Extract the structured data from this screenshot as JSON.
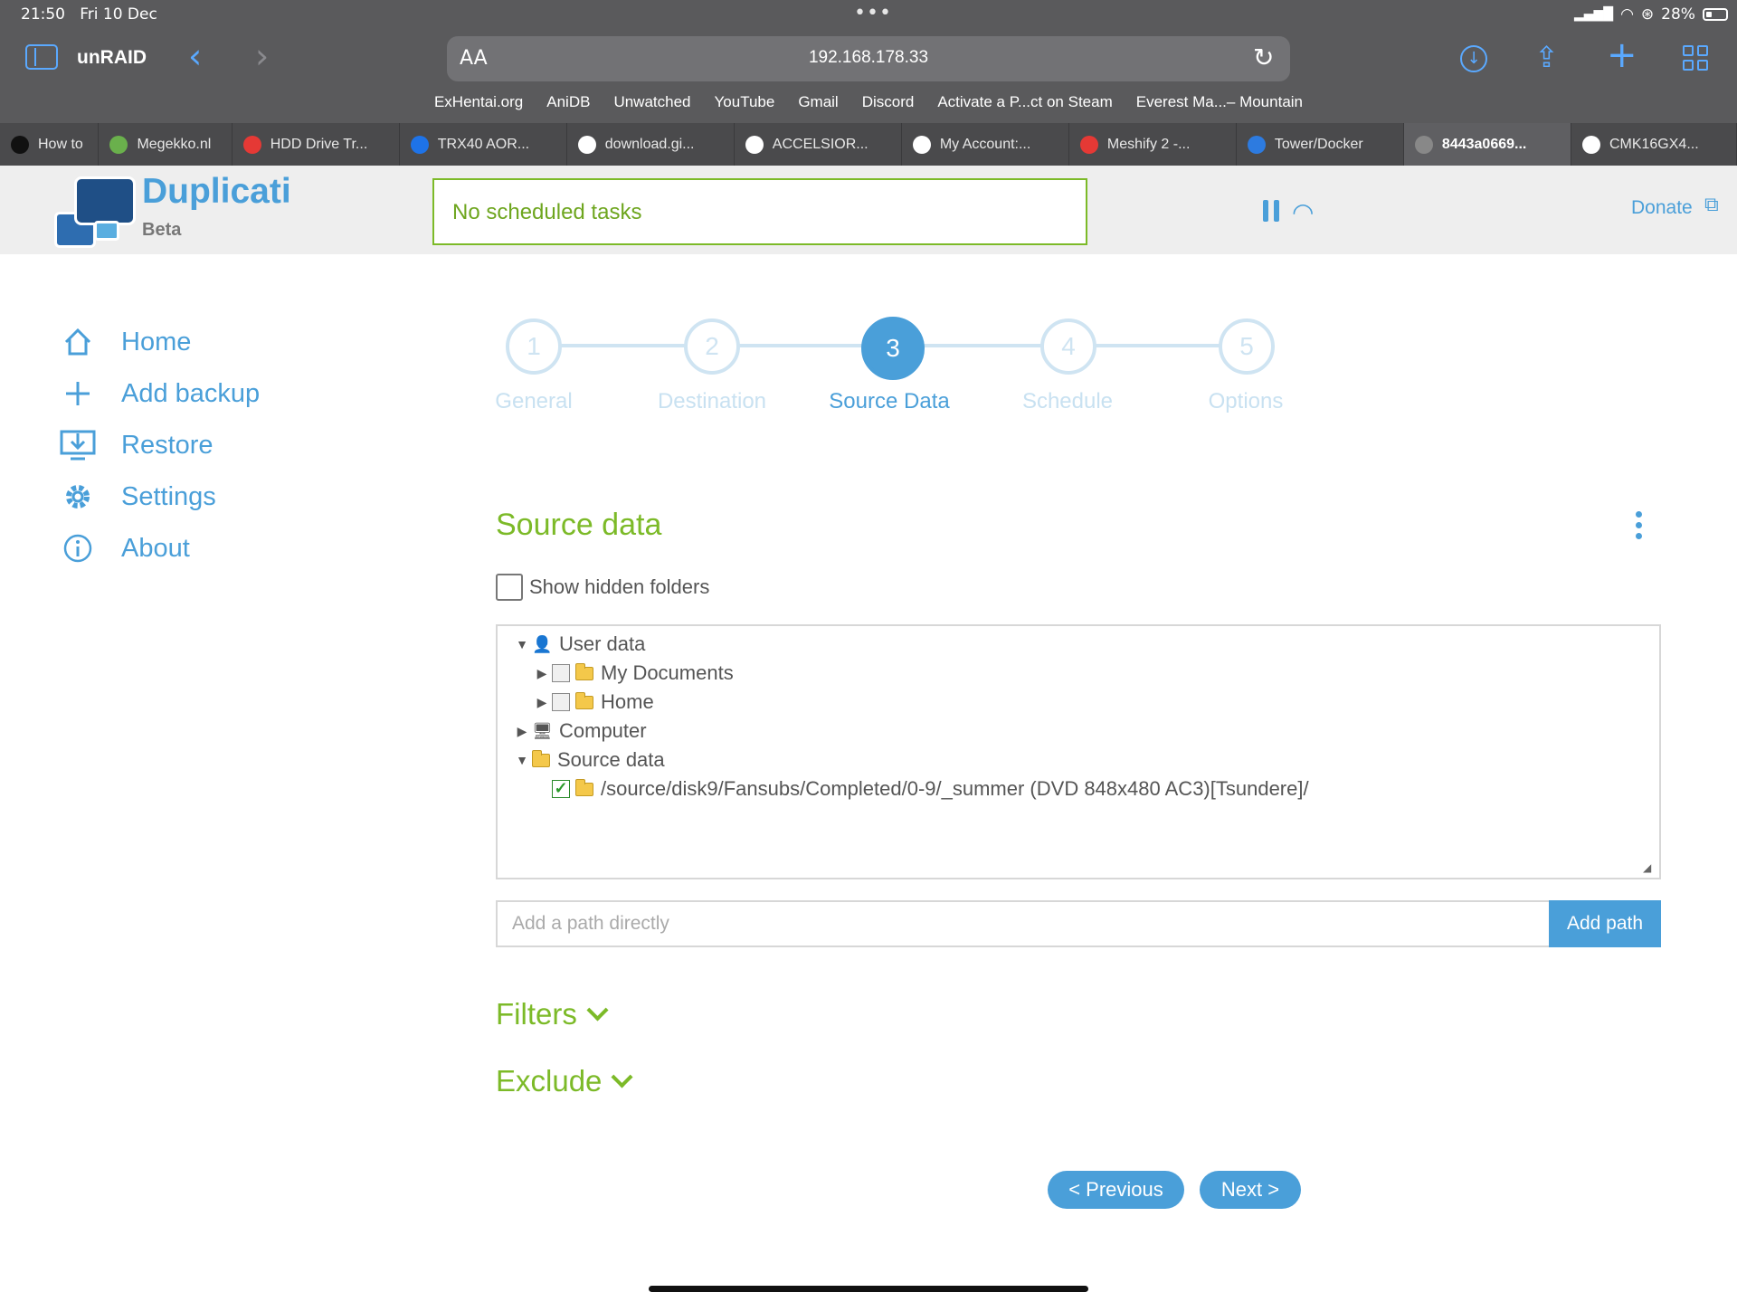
{
  "status_bar": {
    "time": "21:50",
    "date": "Fri 10 Dec",
    "battery": "28%"
  },
  "browser": {
    "site_title": "unRAID",
    "aa_label": "AA",
    "url": "192.168.178.33",
    "bookmarks": [
      "ExHentai.org",
      "AniDB",
      "Unwatched",
      "YouTube",
      "Gmail",
      "Discord",
      "Activate a P...ct on Steam",
      "Everest Ma...– Mountain"
    ],
    "tabs": [
      {
        "label": "How to",
        "fav_color": "#111111"
      },
      {
        "label": "Megekko.nl",
        "fav_color": "#6ab04c"
      },
      {
        "label": "HDD Drive Tr...",
        "fav_color": "#e53935"
      },
      {
        "label": "TRX40 AOR...",
        "fav_color": "#1e73e8"
      },
      {
        "label": "download.gi...",
        "fav_color": "#ffffff"
      },
      {
        "label": "ACCELSIOR...",
        "fav_color": "#ffffff"
      },
      {
        "label": "My Account:...",
        "fav_color": "#ffffff"
      },
      {
        "label": "Meshify 2 -...",
        "fav_color": "#e53935"
      },
      {
        "label": "Tower/Docker",
        "fav_color": "#2d7be0"
      },
      {
        "label": "8443a0669...",
        "fav_color": "#888888"
      },
      {
        "label": "CMK16GX4...",
        "fav_color": "#ffffff"
      }
    ]
  },
  "app": {
    "brand": "Duplicati",
    "brand_sub": "Beta",
    "status": "No scheduled tasks",
    "donate": "Donate",
    "accent": "#4a9fd9",
    "green": "#7cba28"
  },
  "nav": [
    {
      "label": "Home",
      "icon": "home-icon"
    },
    {
      "label": "Add backup",
      "icon": "plus-icon"
    },
    {
      "label": "Restore",
      "icon": "restore-icon"
    },
    {
      "label": "Settings",
      "icon": "gear-icon"
    },
    {
      "label": "About",
      "icon": "info-icon"
    }
  ],
  "steps": [
    {
      "num": "1",
      "label": "General",
      "active": false
    },
    {
      "num": "2",
      "label": "Destination",
      "active": false
    },
    {
      "num": "3",
      "label": "Source Data",
      "active": true
    },
    {
      "num": "4",
      "label": "Schedule",
      "active": false
    },
    {
      "num": "5",
      "label": "Options",
      "active": false
    }
  ],
  "source": {
    "title": "Source data",
    "show_hidden_label": "Show hidden folders",
    "show_hidden_checked": false,
    "tree": {
      "user_data": "User data",
      "my_documents": "My Documents",
      "home": "Home",
      "computer": "Computer",
      "source_data": "Source data",
      "selected_path": "/source/disk9/Fansubs/Completed/0-9/_summer (DVD 848x480 AC3)[Tsundere]/"
    },
    "path_placeholder": "Add a path directly",
    "add_path_label": "Add path",
    "filters_label": "Filters",
    "exclude_label": "Exclude",
    "prev_label": "< Previous",
    "next_label": "Next >"
  }
}
